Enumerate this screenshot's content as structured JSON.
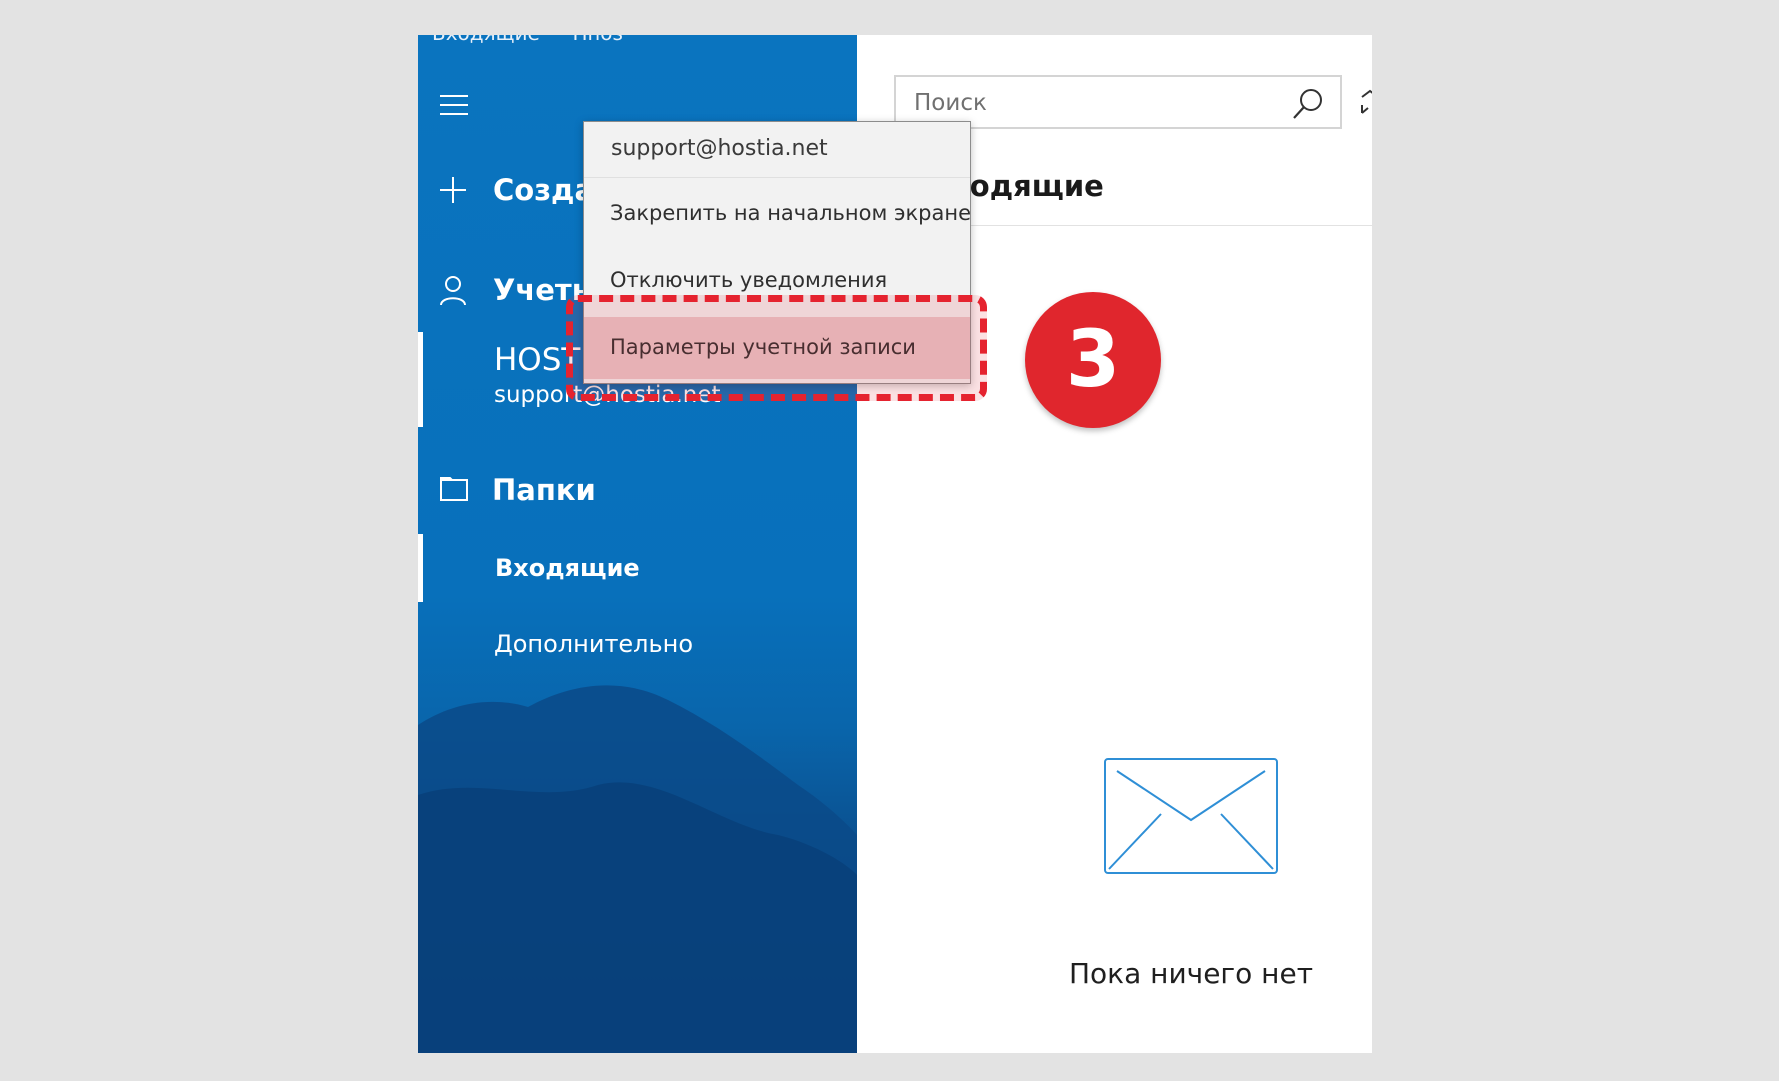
{
  "window": {
    "title": "Входящие — Hnos"
  },
  "sidebar": {
    "new_mail_label": "Создать",
    "accounts_label": "Учетн",
    "account": {
      "name": "HOST",
      "email": "support@hostia.net"
    },
    "folders_label": "Папки",
    "folders": [
      {
        "label": "Входящие"
      },
      {
        "label": "Дополнительно"
      }
    ]
  },
  "main": {
    "search": {
      "placeholder": "Поиск"
    },
    "folder_title": "Входящие",
    "empty_message": "Пока ничего нет"
  },
  "context_menu": {
    "header": "support@hostia.net",
    "items": [
      {
        "label": "Закрепить на начальном экране"
      },
      {
        "label": "Отключить уведомления"
      },
      {
        "label": "Параметры учетной записи"
      }
    ]
  },
  "annotation": {
    "step": "3",
    "color": "#e0262d"
  },
  "colors": {
    "sidebar": "#0a74bf",
    "background": "#e3e3e3"
  },
  "icons": [
    "hamburger-icon",
    "plus-icon",
    "person-icon",
    "folder-icon",
    "search-icon",
    "sync-icon",
    "envelope-icon"
  ]
}
